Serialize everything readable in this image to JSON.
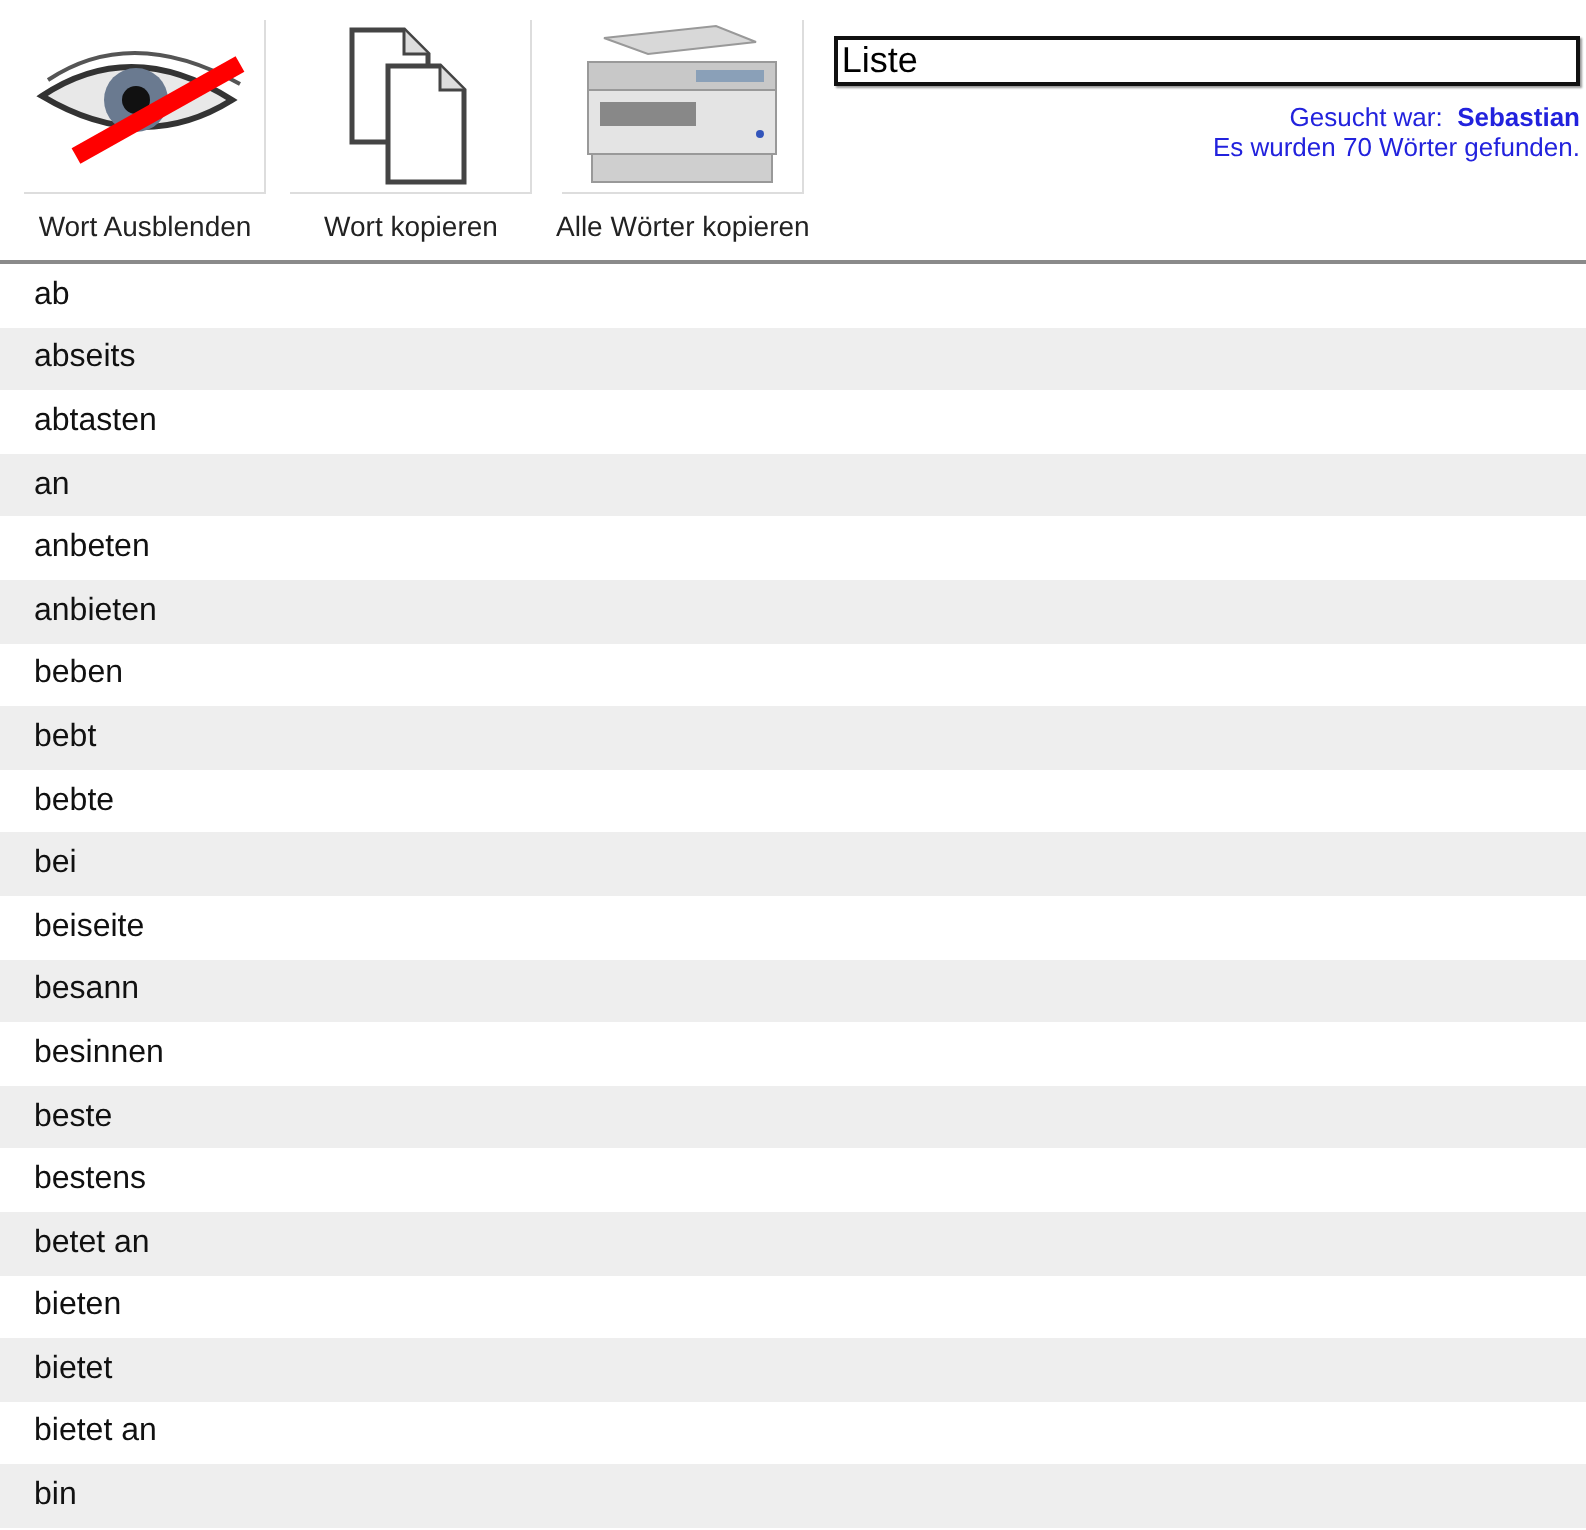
{
  "toolbar": [
    {
      "kind": "hide",
      "label": "Wort Ausblenden"
    },
    {
      "kind": "copy",
      "label": "Wort kopieren"
    },
    {
      "kind": "copy_all",
      "label": "Alle Wörter kopieren"
    }
  ],
  "search": {
    "value": "Liste"
  },
  "info": [
    "Gesucht war:  **Sebastian**",
    "Es wurden 70 Wörter gefunden."
  ],
  "words": [
    "ab",
    "abseits",
    "abtasten",
    "an",
    "anbeten",
    "anbieten",
    "beben",
    "bebt",
    "bebte",
    "bei",
    "beiseite",
    "besann",
    "besinnen",
    "beste",
    "bestens",
    "betet an",
    "bieten",
    "bietet",
    "bietet an",
    "bin"
  ]
}
